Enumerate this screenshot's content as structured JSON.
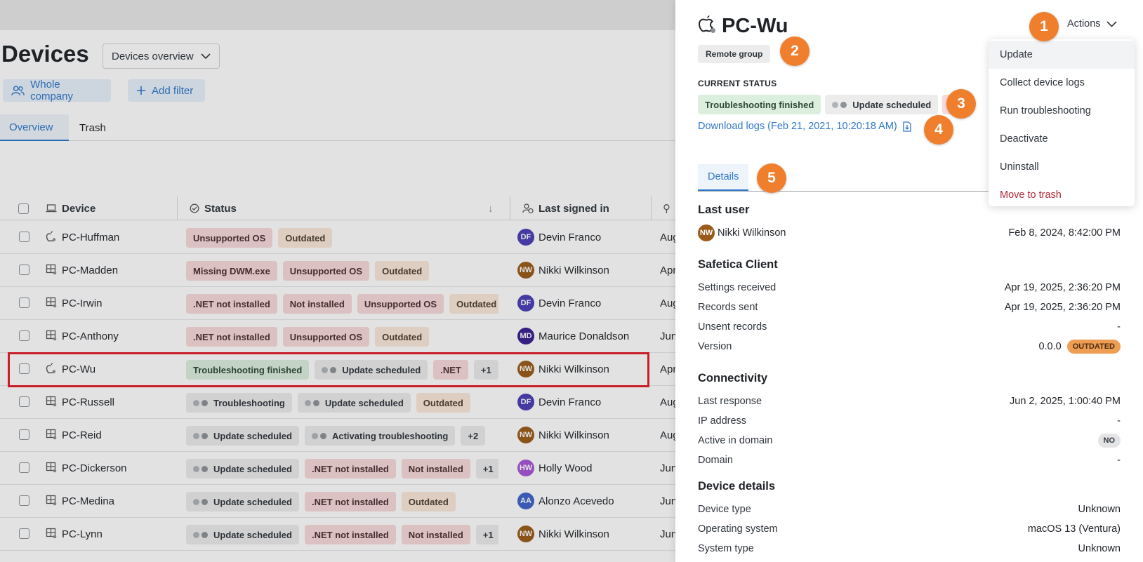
{
  "page": {
    "title": "Devices",
    "view_select": "Devices overview",
    "whole_company": "Whole company",
    "add_filter": "Add filter",
    "tabs": [
      "Overview",
      "Trash"
    ],
    "columns": {
      "device": "Device",
      "status": "Status",
      "last_signed_in": "Last signed in"
    }
  },
  "rows": [
    {
      "device": "PC-Huffman",
      "os": "mac",
      "badges": [
        [
          "Unsupported OS",
          "red"
        ],
        [
          "Outdated",
          "orange"
        ]
      ],
      "user": "Devin Franco",
      "initials": "DF",
      "avatar_color": "#4a3fb5",
      "date": "Aug"
    },
    {
      "device": "PC-Madden",
      "os": "win",
      "badges": [
        [
          "Missing DWM.exe",
          "red"
        ],
        [
          "Unsupported OS",
          "red"
        ],
        [
          "Outdated",
          "orange"
        ]
      ],
      "user": "Nikki Wilkinson",
      "initials": "NW",
      "avatar_color": "#9a5b1a",
      "date": "Apr"
    },
    {
      "device": "PC-Irwin",
      "os": "win",
      "badges": [
        [
          ".NET not installed",
          "red"
        ],
        [
          "Not installed",
          "red"
        ],
        [
          "Unsupported OS",
          "red"
        ],
        [
          "Outdated",
          "orange"
        ]
      ],
      "user": "Devin Franco",
      "initials": "DF",
      "avatar_color": "#4a3fb5",
      "date": "Aug"
    },
    {
      "device": "PC-Anthony",
      "os": "win",
      "badges": [
        [
          ".NET not installed",
          "red"
        ],
        [
          "Unsupported OS",
          "red"
        ],
        [
          "Outdated",
          "orange"
        ]
      ],
      "user": "Maurice Donaldson",
      "initials": "MD",
      "avatar_color": "#3a1f8f",
      "date": "Jun"
    },
    {
      "device": "PC-Wu",
      "os": "mac",
      "badges": [
        [
          "Troubleshooting finished",
          "green"
        ],
        [
          "Update scheduled",
          "gray-dots"
        ],
        [
          ".NET",
          "red"
        ],
        [
          "+1",
          "gray"
        ]
      ],
      "user": "Nikki Wilkinson",
      "initials": "NW",
      "avatar_color": "#9a5b1a",
      "date": "Apr"
    },
    {
      "device": "PC-Russell",
      "os": "win",
      "badges": [
        [
          "Troubleshooting",
          "gray-dots"
        ],
        [
          "Update scheduled",
          "gray-dots"
        ],
        [
          "Outdated",
          "orange"
        ]
      ],
      "user": "Devin Franco",
      "initials": "DF",
      "avatar_color": "#4a3fb5",
      "date": "Aug"
    },
    {
      "device": "PC-Reid",
      "os": "win",
      "badges": [
        [
          "Update scheduled",
          "gray-dots"
        ],
        [
          "Activating troubleshooting",
          "gray-dots"
        ],
        [
          "+2",
          "gray"
        ]
      ],
      "user": "Nikki Wilkinson",
      "initials": "NW",
      "avatar_color": "#9a5b1a",
      "date": "Aug"
    },
    {
      "device": "PC-Dickerson",
      "os": "win",
      "badges": [
        [
          "Update scheduled",
          "gray-dots"
        ],
        [
          ".NET not installed",
          "red"
        ],
        [
          "Not installed",
          "red"
        ],
        [
          "+1",
          "gray"
        ]
      ],
      "user": "Holly Wood",
      "initials": "HW",
      "avatar_color": "#a855d6",
      "date": "Jun"
    },
    {
      "device": "PC-Medina",
      "os": "win",
      "badges": [
        [
          "Update scheduled",
          "gray-dots"
        ],
        [
          ".NET not installed",
          "red"
        ],
        [
          "Outdated",
          "orange"
        ]
      ],
      "user": "Alonzo Acevedo",
      "initials": "AA",
      "avatar_color": "#3f63c9",
      "date": "Jun"
    },
    {
      "device": "PC-Lynn",
      "os": "win",
      "badges": [
        [
          "Update scheduled",
          "gray-dots"
        ],
        [
          ".NET not installed",
          "red"
        ],
        [
          "Not installed",
          "red"
        ],
        [
          "+1",
          "gray"
        ]
      ],
      "user": "Nikki Wilkinson",
      "initials": "NW",
      "avatar_color": "#9a5b1a",
      "date": "Jun"
    }
  ],
  "panel": {
    "title": "PC-Wu",
    "group": "Remote group",
    "current_status_label": "CURRENT STATUS",
    "status_badges": [
      "Troubleshooting finished",
      "Update scheduled"
    ],
    "download_logs": "Download logs (Feb 21, 2021, 10:20:18 AM)",
    "tab_details": "Details",
    "actions_label": "Actions",
    "actions_menu": [
      "Update",
      "Collect device logs",
      "Run troubleshooting",
      "Deactivate",
      "Uninstall",
      "Move to trash"
    ],
    "last_user": {
      "heading": "Last user",
      "name": "Nikki Wilkinson",
      "initials": "NW",
      "date": "Feb 8, 2024, 8:42:00 PM"
    },
    "client": {
      "heading": "Safetica Client",
      "settings_received_label": "Settings received",
      "settings_received": "Apr 19, 2025, 2:36:20 PM",
      "records_sent_label": "Records sent",
      "records_sent": "Apr 19, 2025, 2:36:20 PM",
      "unsent_records_label": "Unsent records",
      "unsent_records": "-",
      "version_label": "Version",
      "version": "0.0.0",
      "version_badge": "OUTDATED"
    },
    "connectivity": {
      "heading": "Connectivity",
      "last_response_label": "Last response",
      "last_response": "Jun 2, 2025, 1:00:40 PM",
      "ip_label": "IP address",
      "ip": "-",
      "active_label": "Active in domain",
      "active": "NO",
      "domain_label": "Domain",
      "domain": "-"
    },
    "device": {
      "heading": "Device details",
      "type_label": "Device type",
      "type": "Unknown",
      "os_label": "Operating system",
      "os": "macOS 13 (Ventura)",
      "system_label": "System type",
      "system": "Unknown"
    }
  },
  "callouts": [
    "1",
    "2",
    "3",
    "4",
    "5"
  ],
  "colors": {
    "accent": "#2f77c9",
    "callout": "#ef7f2c",
    "highlight": "#e31e2b",
    "danger": "#b0283a"
  }
}
